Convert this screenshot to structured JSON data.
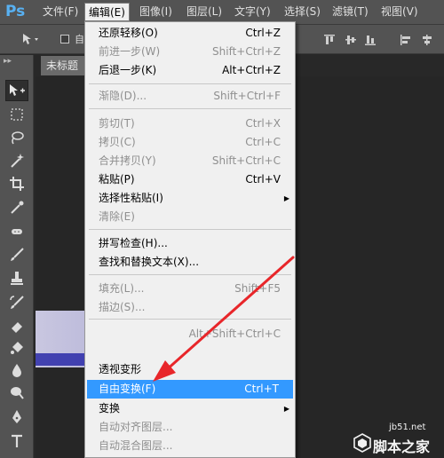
{
  "app": {
    "logo": "Ps"
  },
  "menubar": {
    "items": [
      "文件(F)",
      "编辑(E)",
      "图像(I)",
      "图层(L)",
      "文字(Y)",
      "选择(S)",
      "滤镜(T)",
      "视图(V)"
    ],
    "active_index": 1
  },
  "optionsbar": {
    "auto_select_label": "自"
  },
  "document": {
    "tab_title": "未标题"
  },
  "edit_menu": {
    "items": [
      {
        "label": "还原轻移(O)",
        "shortcut": "Ctrl+Z",
        "enabled": true
      },
      {
        "label": "前进一步(W)",
        "shortcut": "Shift+Ctrl+Z",
        "enabled": false
      },
      {
        "label": "后退一步(K)",
        "shortcut": "Alt+Ctrl+Z",
        "enabled": true
      },
      {
        "label": "渐隐(D)...",
        "shortcut": "Shift+Ctrl+F",
        "enabled": false
      },
      {
        "label": "剪切(T)",
        "shortcut": "Ctrl+X",
        "enabled": false
      },
      {
        "label": "拷贝(C)",
        "shortcut": "Ctrl+C",
        "enabled": false
      },
      {
        "label": "合并拷贝(Y)",
        "shortcut": "Shift+Ctrl+C",
        "enabled": false
      },
      {
        "label": "粘贴(P)",
        "shortcut": "Ctrl+V",
        "enabled": true
      },
      {
        "label": "选择性粘贴(I)",
        "shortcut": "",
        "enabled": true,
        "submenu": true
      },
      {
        "label": "清除(E)",
        "shortcut": "",
        "enabled": false
      },
      {
        "label": "拼写检查(H)...",
        "shortcut": "",
        "enabled": true
      },
      {
        "label": "查找和替换文本(X)...",
        "shortcut": "",
        "enabled": true
      },
      {
        "label": "填充(L)...",
        "shortcut": "Shift+F5",
        "enabled": false
      },
      {
        "label": "描边(S)...",
        "shortcut": "",
        "enabled": false
      },
      {
        "label": "",
        "shortcut": "Alt+Shift+Ctrl+C",
        "enabled": false
      },
      {
        "label": "透视变形",
        "shortcut": "",
        "enabled": true
      },
      {
        "label": "自由变换(F)",
        "shortcut": "Ctrl+T",
        "enabled": true,
        "highlighted": true
      },
      {
        "label": "变换",
        "shortcut": "",
        "enabled": true,
        "submenu": true
      },
      {
        "label": "自动对齐图层...",
        "shortcut": "",
        "enabled": false
      },
      {
        "label": "自动混合图层...",
        "shortcut": "",
        "enabled": false
      }
    ]
  },
  "watermark": {
    "url": "jb51.net",
    "name": "脚本之家"
  },
  "colors": {
    "highlight": "#3399ff",
    "ps_logo": "#58b1f2",
    "arrow": "#e8262a"
  },
  "icons": [
    "move-tool-icon",
    "marquee-icon",
    "lasso-icon",
    "magic-wand-icon",
    "crop-icon",
    "eyedropper-icon",
    "healing-brush-icon",
    "brush-icon",
    "clone-stamp-icon",
    "history-brush-icon",
    "eraser-icon",
    "paint-bucket-icon",
    "blur-icon",
    "dodge-icon",
    "pen-icon",
    "type-icon"
  ]
}
